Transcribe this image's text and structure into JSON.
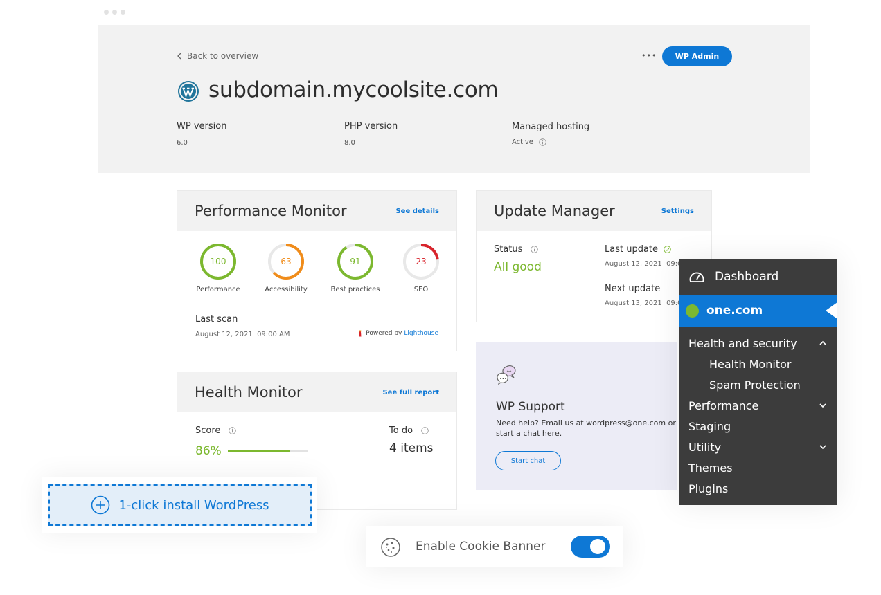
{
  "header": {
    "back_label": "Back to overview",
    "more_label": "•••",
    "wp_admin_label": "WP Admin",
    "site_title": "subdomain.mycoolsite.com",
    "wp_version_label": "WP version",
    "wp_version_value": "6.0",
    "php_version_label": "PHP version",
    "php_version_value": "8.0",
    "hosting_label": "Managed hosting",
    "hosting_value": "Active"
  },
  "performance": {
    "title": "Performance Monitor",
    "link": "See details",
    "gauges": [
      {
        "label": "Performance",
        "value": 100,
        "color": "#7cb82f"
      },
      {
        "label": "Accessibility",
        "value": 63,
        "color": "#f08c1a"
      },
      {
        "label": "Best practices",
        "value": 91,
        "color": "#7cb82f"
      },
      {
        "label": "SEO",
        "value": 23,
        "color": "#d8242c"
      }
    ],
    "last_scan_label": "Last scan",
    "last_scan_value": "August 12, 2021  09:00 AM",
    "powered_prefix": "Powered by",
    "powered_link": "Lighthouse"
  },
  "health": {
    "title": "Health Monitor",
    "link": "See full report",
    "score_label": "Score",
    "score_value": "86%",
    "score_fraction": 0.78,
    "todo_label": "To do",
    "todo_value": "4 items"
  },
  "update": {
    "title": "Update Manager",
    "link": "Settings",
    "status_label": "Status",
    "status_value": "All good",
    "last_update_label": "Last update",
    "last_update_value": "August 12, 2021  09:0",
    "next_update_label": "Next update",
    "next_update_value": "August 13, 2021  09:0"
  },
  "support": {
    "title": "WP Support",
    "text_line1": "Need help? Email us at wordpress@one.com or",
    "text_line2": "start a chat here.",
    "button": "Start chat"
  },
  "menu": {
    "dashboard": "Dashboard",
    "brand": "one.com",
    "items": [
      "Health and security",
      "Health Monitor",
      "Spam Protection",
      "Performance",
      "Staging",
      "Utility",
      "Themes",
      "Plugins"
    ]
  },
  "install": {
    "label": "1-click install WordPress"
  },
  "cookie": {
    "label": "Enable Cookie Banner",
    "enabled": true
  },
  "colors": {
    "accent": "#0e78d5",
    "good": "#7cb82f",
    "warn": "#f08c1a",
    "bad": "#d8242c",
    "menu_bg": "#3c3c3c"
  }
}
